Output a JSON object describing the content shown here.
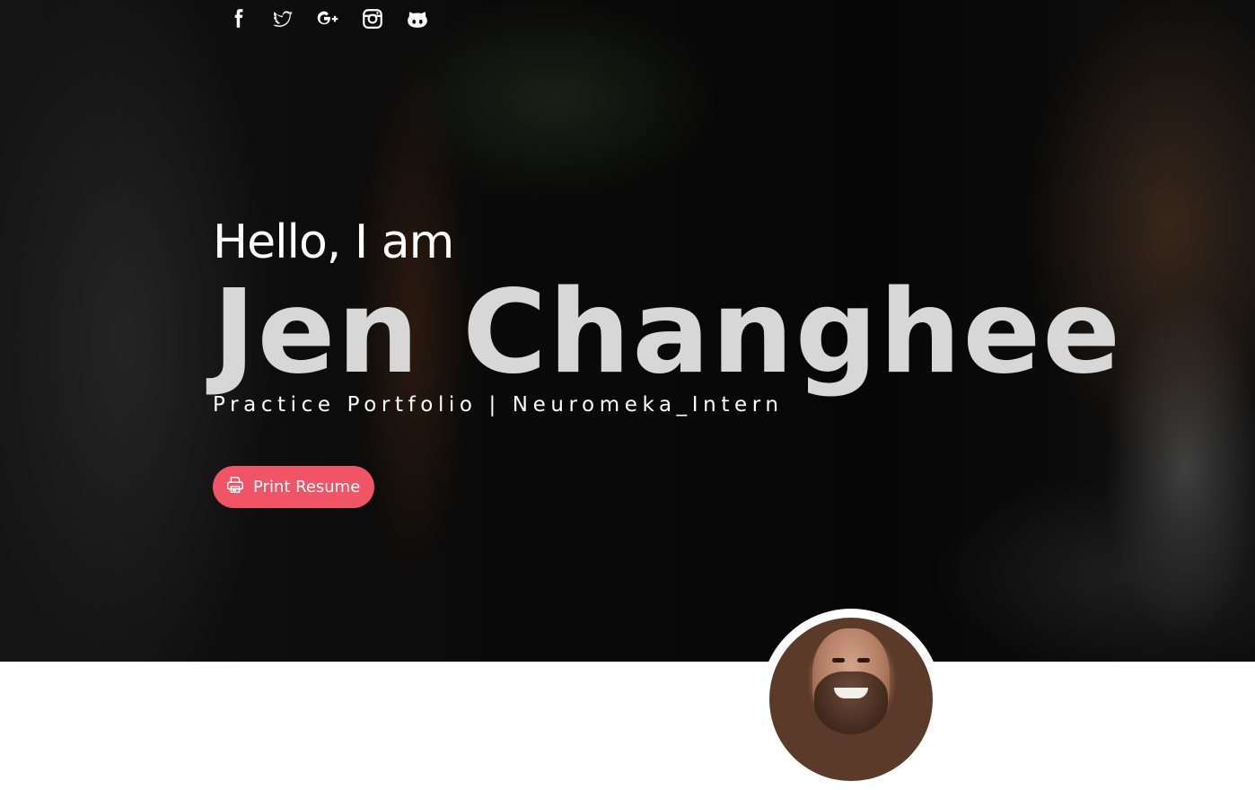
{
  "social": {
    "links": [
      {
        "name": "facebook"
      },
      {
        "name": "twitter"
      },
      {
        "name": "google-plus"
      },
      {
        "name": "instagram"
      },
      {
        "name": "github"
      }
    ]
  },
  "hero": {
    "greeting": "Hello, I am",
    "name": "Jen Changhee",
    "subtitle": "Practice Portfolio | Neuromeka_Intern"
  },
  "print_button": {
    "label": "Print Resume",
    "icon": "printer-icon",
    "color": "#ef5467"
  },
  "colors": {
    "accent": "#ef5467",
    "name_text": "#d7d7d7",
    "text": "#ffffff"
  }
}
